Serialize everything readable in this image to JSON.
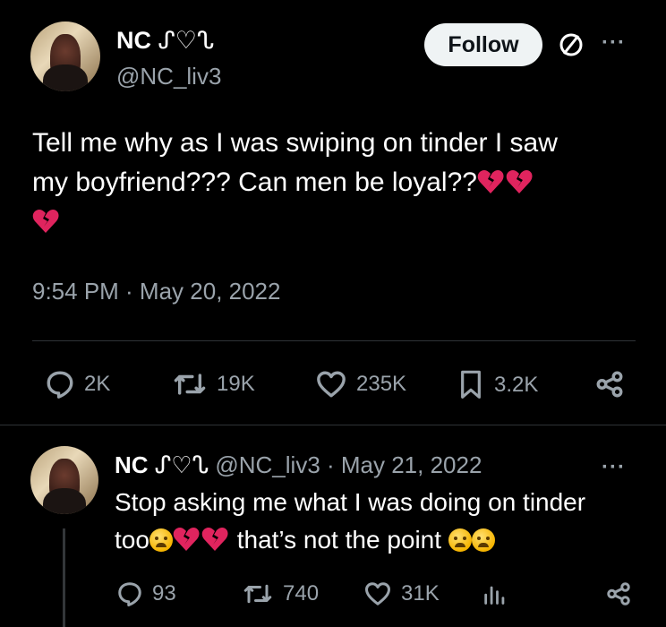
{
  "main_tweet": {
    "author_name": "NC",
    "author_deco": "ᔑ♡ᔐ",
    "handle": "@NC_liv3",
    "follow_label": "Follow",
    "text_line1": "Tell me why as I was swiping on tinder I saw",
    "text_line2": "my boyfriend??? Can men be loyal??",
    "timestamp": "9:54 PM · May 20, 2022",
    "replies": "2K",
    "retweets": "19K",
    "likes": "235K",
    "bookmarks": "3.2K"
  },
  "reply_tweet": {
    "author_name": "NC",
    "author_deco": "ᔑ♡ᔐ",
    "handle_date": "@NC_liv3 · May 21, 2022",
    "text_line1": "Stop asking me what I was doing on tinder",
    "text_part2a": "too",
    "text_part2b": " that’s not the point",
    "replies": "93",
    "retweets": "740",
    "likes": "31K"
  },
  "icons": [
    "ignore-icon",
    "more-icon",
    "reply-icon",
    "retweet-icon",
    "like-icon",
    "bookmark-icon",
    "share-icon",
    "views-icon",
    "broken-heart-emoji",
    "tired-face-emoji",
    "pleading-face-emoji"
  ],
  "colors": {
    "background": "#000000",
    "text": "#ffffff",
    "muted": "#9aa3ab",
    "divider": "#2f3336",
    "heart": "#e0245e"
  }
}
